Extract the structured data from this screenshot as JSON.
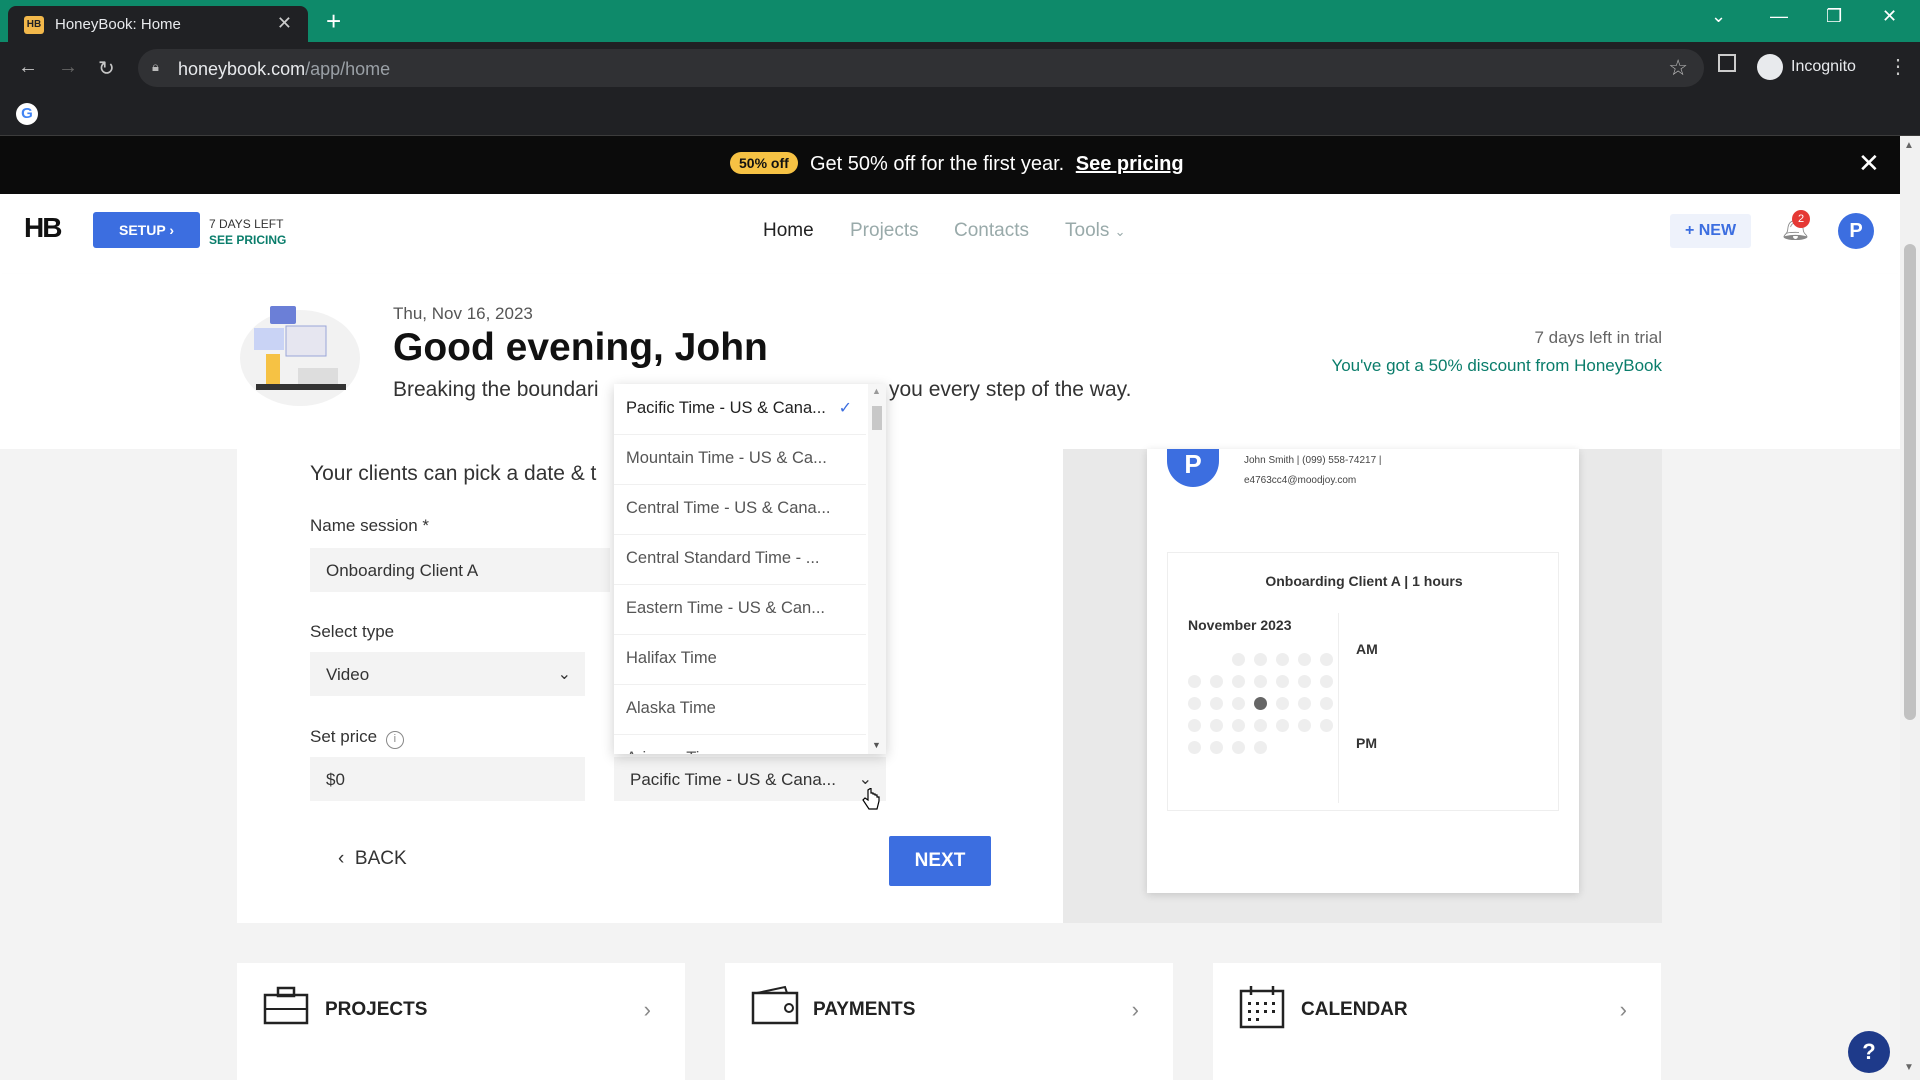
{
  "browser": {
    "tab_title": "HoneyBook: Home",
    "tab_favicon": "HB",
    "url_host": "honeybook.com",
    "url_path": "/app/home",
    "profile_label": "Incognito"
  },
  "promo": {
    "badge": "50% off",
    "text": "Get 50% off for the first year.",
    "link": "See pricing"
  },
  "appnav": {
    "logo": "HB",
    "setup_label": "SETUP",
    "days_left": "7 DAYS LEFT",
    "see_pricing": "SEE PRICING",
    "links": [
      "Home",
      "Projects",
      "Contacts",
      "Tools"
    ],
    "new_label": "NEW",
    "notif_count": "2",
    "avatar": "P"
  },
  "hero": {
    "date": "Thu, Nov 16, 2023",
    "greeting": "Good evening, John",
    "tagline_start": "Breaking the boundari",
    "tagline_end": "you every step of the way.",
    "trial": "7 days left in trial",
    "discount": "You've got a 50% discount from HoneyBook"
  },
  "form": {
    "intro": "Your clients can pick a date & t",
    "name_label": "Name session *",
    "name_value": "Onboarding Client A",
    "type_label": "Select type",
    "type_value": "Video",
    "price_label": "Set price",
    "price_value": "$0",
    "timezone_value": "Pacific Time - US & Cana...",
    "back_label": "BACK",
    "next_label": "NEXT"
  },
  "timezone_options": [
    "Pacific Time - US & Cana...",
    "Mountain Time - US & Ca...",
    "Central Time - US & Cana...",
    "Central Standard Time - ...",
    "Eastern Time - US & Can...",
    "Halifax Time",
    "Alaska Time",
    "Arizona Time"
  ],
  "preview": {
    "avatar": "P",
    "contact": "John Smith | (099) 558-74217 |",
    "email": "e4763cc4@moodjoy.com",
    "session": "Onboarding Client A | 1 hours",
    "month": "November 2023",
    "am": "AM",
    "pm": "PM"
  },
  "tiles": [
    "PROJECTS",
    "PAYMENTS",
    "CALENDAR"
  ],
  "help": "?",
  "colors": {
    "accent": "#3c6ee0",
    "teal": "#0a7d6b",
    "tabbar": "#0e8a6a",
    "badge": "#f6c244"
  }
}
